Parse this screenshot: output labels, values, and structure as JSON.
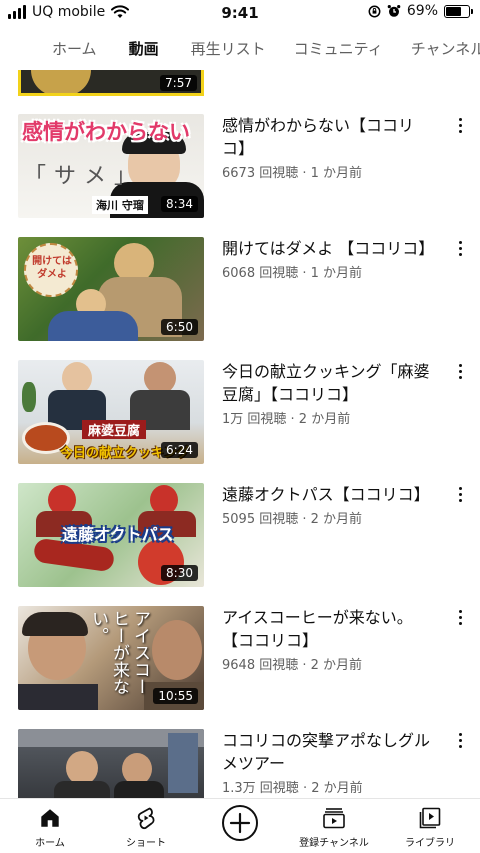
{
  "status_bar": {
    "carrier": "UQ mobile",
    "time": "9:41",
    "battery": "69%",
    "battery_level": 0.69
  },
  "tabs": [
    {
      "label": "ホーム",
      "active": false
    },
    {
      "label": "動画",
      "active": true
    },
    {
      "label": "再生リスト",
      "active": false
    },
    {
      "label": "コミュニティ",
      "active": false
    },
    {
      "label": "チャンネル",
      "active": false
    }
  ],
  "partial_video": {
    "duration": "7:57"
  },
  "videos": [
    {
      "title": "感情がわからない【ココリコ】",
      "meta": "6673 回視聴 · 1 か月前",
      "duration": "8:34",
      "overlay": "感情がわからない",
      "caption": "海川 守瑠"
    },
    {
      "title": "開けてはダメよ 【ココリコ】",
      "meta": "6068 回視聴 · 1 か月前",
      "duration": "6:50",
      "overlay": "開けては ダメよ"
    },
    {
      "title": "今日の献立クッキング「麻婆豆腐」【ココリコ】",
      "meta": "1万 回視聴 · 2 か月前",
      "duration": "6:24",
      "overlay": "麻婆豆腐",
      "caption": "今日の献立クッキング"
    },
    {
      "title": "遠藤オクトパス【ココリコ】",
      "meta": "5095 回視聴 · 2 か月前",
      "duration": "8:30",
      "overlay": "遠藤オクトパス"
    },
    {
      "title": "アイスコーヒーが来ない。【ココリコ】",
      "meta": "9648 回視聴 · 2 か月前",
      "duration": "10:55",
      "overlay": "アイスコーヒーが来ない。"
    },
    {
      "title": "ココリコの突撃アポなしグルメツアー",
      "meta": "1.3万 回視聴 · 2 か月前",
      "duration": ""
    }
  ],
  "bottom_nav": [
    {
      "label": "ホーム",
      "icon": "home-icon",
      "active": true
    },
    {
      "label": "ショート",
      "icon": "shorts-icon",
      "active": false
    },
    {
      "label": "",
      "icon": "create-icon",
      "active": false
    },
    {
      "label": "登録チャンネル",
      "icon": "subscriptions-icon",
      "active": false
    },
    {
      "label": "ライブラリ",
      "icon": "library-icon",
      "active": false
    }
  ]
}
